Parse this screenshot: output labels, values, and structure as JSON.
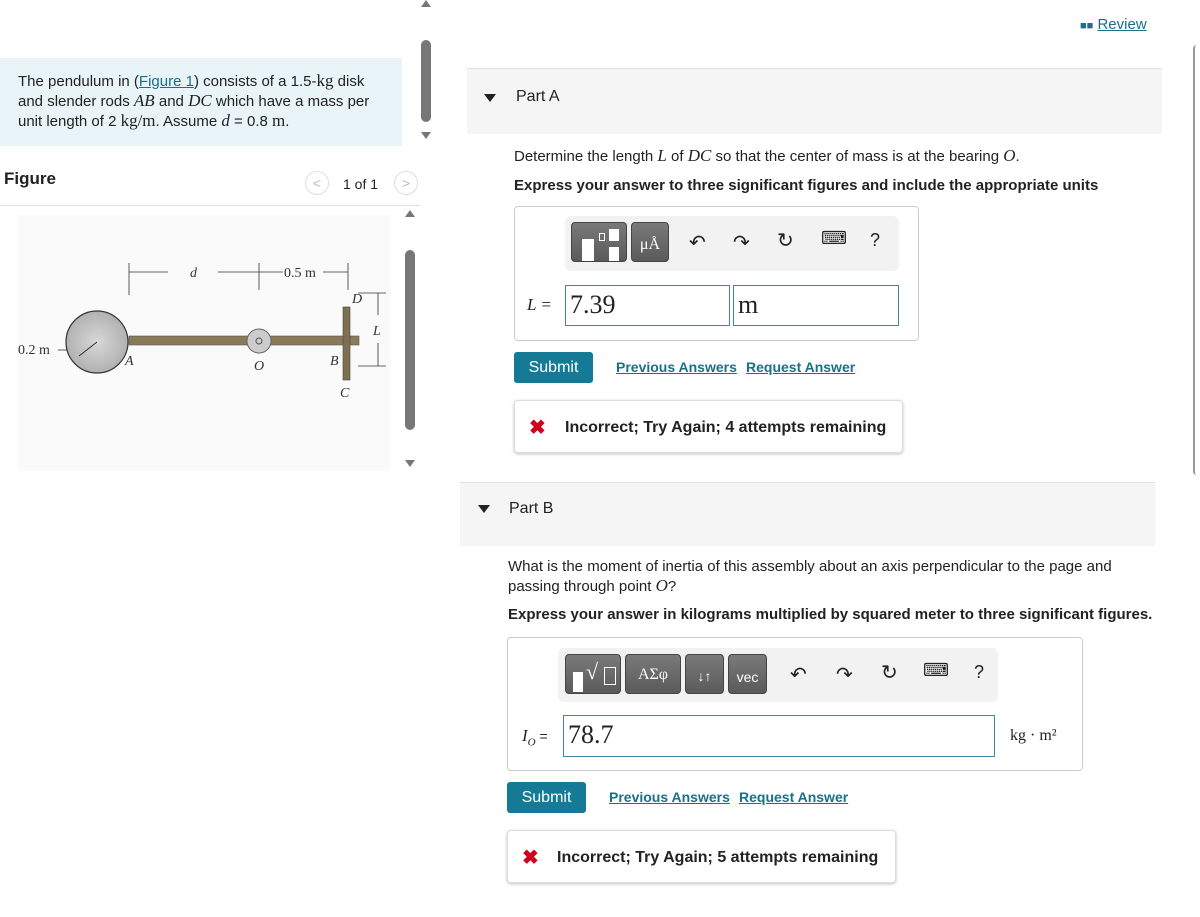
{
  "problem": {
    "text_1": "The pendulum in (",
    "figure_link": "Figure 1",
    "text_2": ") consists of a 1.5-",
    "kg": "kg",
    "text_3": " disk and slender rods ",
    "AB": "AB",
    "and": " and ",
    "DC": "DC",
    "text_4": " which have a mass per unit length of 2 ",
    "kgm": "kg/m",
    "text_5": ". Assume ",
    "d": "d",
    "text_6": " = 0.8 ",
    "m": "m",
    "text_7": "."
  },
  "figure": {
    "heading": "Figure",
    "pager": "1 of 1",
    "labels": {
      "d": "d",
      "half": "0.5 m",
      "radius": "0.2 m",
      "A": "A",
      "O": "O",
      "B": "B",
      "C": "C",
      "D": "D",
      "L": "L"
    }
  },
  "review": {
    "label": "Review",
    "color": "#1a6f8a"
  },
  "part_a": {
    "title": "Part A",
    "q1": "Determine the length ",
    "L": "L",
    "q2": " of ",
    "DC": "DC",
    "q3": " so that the center of mass is at the bearing ",
    "O": "O",
    "q4": ".",
    "instruction": "Express your answer to three significant figures and include the appropriate units",
    "var_label": "L =",
    "value": "7.39",
    "unit": "m",
    "toolbar": [
      "templates-icon",
      "units-icon",
      "undo-icon",
      "redo-icon",
      "reset-icon",
      "keyboard-icon",
      "help-icon"
    ],
    "units_btn": "μÅ",
    "help": "?",
    "submit": "Submit",
    "previous": "Previous Answers",
    "request": "Request Answer",
    "feedback": "Incorrect; Try Again; 4 attempts remaining"
  },
  "part_b": {
    "title": "Part B",
    "q1": "What is the moment of inertia of this assembly about an axis perpendicular to the page and passing through point ",
    "O": "O",
    "q2": "?",
    "instruction": "Express your answer in kilograms multiplied by squared meter to three significant figures.",
    "var_label": "I",
    "var_sub": "O",
    "eq": " =",
    "value": "78.7",
    "unit": "kg · m²",
    "greek_btn": "ΑΣφ",
    "arrows_btn": "↓↑",
    "vec_btn": "vec",
    "help": "?",
    "submit": "Submit",
    "previous": "Previous Answers",
    "request": "Request Answer",
    "feedback": "Incorrect; Try Again; 5 attempts remaining"
  },
  "colors": {
    "accent": "#157a96",
    "error": "#d0021b",
    "problem_bg": "#e8f4f7"
  }
}
